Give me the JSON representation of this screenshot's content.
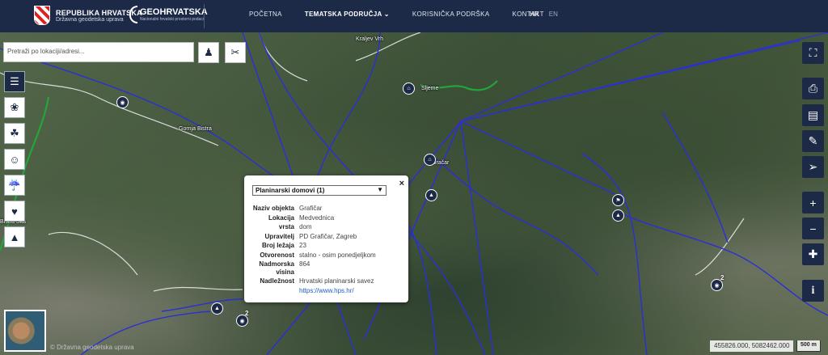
{
  "header": {
    "org_name": "REPUBLIKA HRVATSKA",
    "org_sub": "Državna geodetska uprava",
    "brand": "GEOHRVATSKA",
    "brand_sub": "Nacionalni hrvatski prostorni podaci",
    "nav": [
      "POČETNA",
      "TEMATSKA PODRUČJA",
      "KORISNIČKA PODRŠKA",
      "KONTAKT"
    ],
    "nav_dropdown_icon": "chevron-down-icon",
    "lang_active": "HR",
    "lang_other": "EN"
  },
  "search": {
    "placeholder": "Pretraži po lokaciji/adresi..."
  },
  "map": {
    "places": [
      "Kraljev Vrh",
      "Gornja Bistra",
      "Sljeme",
      "Bistra Ska",
      "Gračar"
    ],
    "cluster_counts": [
      "2",
      "2"
    ]
  },
  "popup": {
    "layer_select": "Planinarski domovi (1)",
    "close": "×",
    "rows": [
      {
        "k": "Naziv objekta",
        "v": "Grafičar"
      },
      {
        "k": "Lokacija",
        "v": "Medvednica"
      },
      {
        "k": "vrsta",
        "v": "dom"
      },
      {
        "k": "Upravitelj",
        "v": "PD Grafičar, Zagreb"
      },
      {
        "k": "Broj ležaja",
        "v": "23"
      },
      {
        "k": "Otvorenost",
        "v": "stalno - osim ponedjeljkom"
      },
      {
        "k": "Nadmorska visina",
        "v": "864"
      },
      {
        "k": "Nadležnost",
        "v": "Hrvatski planinarski savez"
      }
    ],
    "link": "https://www.hps.hr/"
  },
  "footer": {
    "attribution": "© Državna geodetska uprava",
    "coordinates": "455826.000, 5082462.000",
    "scale": "500 m"
  },
  "colors": {
    "header_bg": "#1c2a47",
    "route": "#2b2fd6",
    "path": "#22a63a"
  }
}
